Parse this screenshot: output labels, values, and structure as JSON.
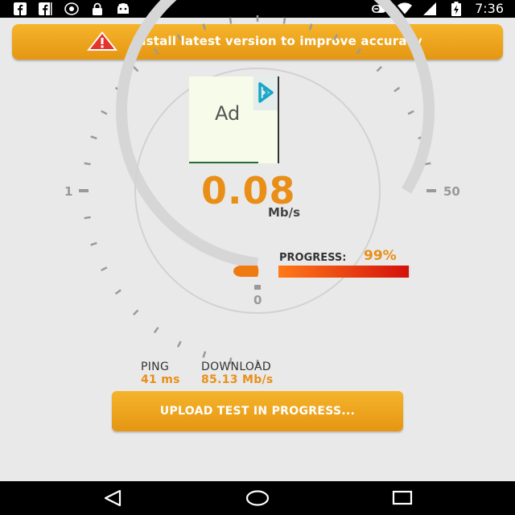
{
  "status_bar": {
    "time": "7:36",
    "left_icons": [
      "facebook-icon",
      "facebook-messenger-icon",
      "record-icon",
      "lock-icon",
      "android-icon"
    ],
    "right_icons": [
      "toggle-icon",
      "wifi-icon",
      "signal-icon",
      "battery-charging-icon"
    ]
  },
  "banner": {
    "text": "Install latest version to improve accuracy",
    "icon": "warning-icon"
  },
  "ad": {
    "label": "Ad",
    "icon": "ad-choices-icon"
  },
  "gauge": {
    "value": "0.08",
    "unit": "Mb/s",
    "scale_min": "1",
    "scale_max": "50",
    "scale_zero": "0"
  },
  "progress": {
    "label": "PROGRESS:",
    "value_text": "99%",
    "percent": 99
  },
  "stats": {
    "ping_label": "PING",
    "ping_value": "41 ms",
    "download_label": "DOWNLOAD",
    "download_value": "85.13 Mb/s"
  },
  "action_button": {
    "label": "UPLOAD TEST IN PROGRESS..."
  },
  "colors": {
    "accent": "#e98f17",
    "banner": "#f0a41f",
    "progress_start": "#ff7a18",
    "progress_end": "#d4100c"
  },
  "nav_bar": {
    "items": [
      "back-icon",
      "home-icon",
      "recents-icon"
    ]
  }
}
